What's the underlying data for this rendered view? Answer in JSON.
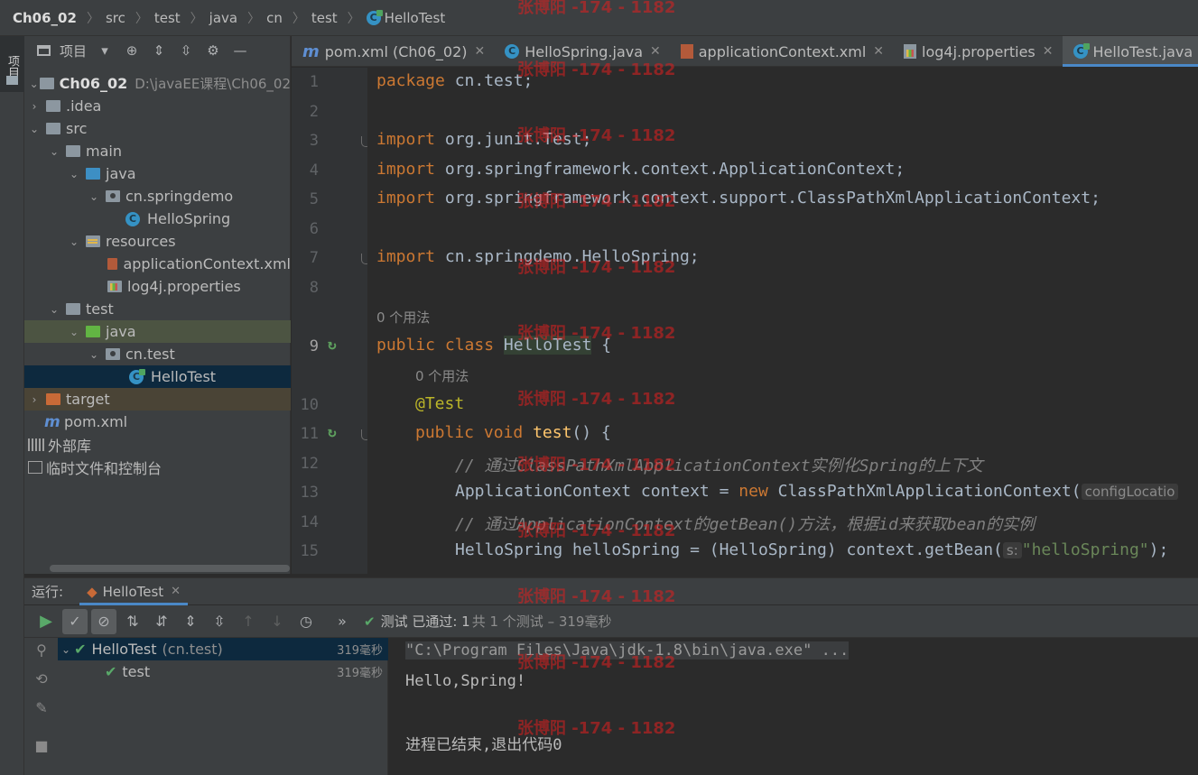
{
  "breadcrumb": {
    "items": [
      "Ch06_02",
      "src",
      "test",
      "java",
      "cn",
      "test",
      "HelloTest"
    ]
  },
  "left_stripe": {
    "project_tab": "项目"
  },
  "project_panel": {
    "title": "项目",
    "tree": [
      {
        "label": "Ch06_02",
        "path": "D:\\javaEE课程\\Ch06_02"
      },
      {
        "label": ".idea"
      },
      {
        "label": "src"
      },
      {
        "label": "main"
      },
      {
        "label": "java"
      },
      {
        "label": "cn.springdemo"
      },
      {
        "label": "HelloSpring"
      },
      {
        "label": "resources"
      },
      {
        "label": "applicationContext.xml"
      },
      {
        "label": "log4j.properties"
      },
      {
        "label": "test"
      },
      {
        "label": "java"
      },
      {
        "label": "cn.test"
      },
      {
        "label": "HelloTest"
      },
      {
        "label": "target"
      },
      {
        "label": "pom.xml"
      },
      {
        "label": "外部库"
      },
      {
        "label": "临时文件和控制台"
      }
    ]
  },
  "editor_tabs": [
    {
      "label": "pom.xml (Ch06_02)",
      "icon": "maven-icon"
    },
    {
      "label": "HelloSpring.java",
      "icon": "class-icon"
    },
    {
      "label": "applicationContext.xml",
      "icon": "xml-icon"
    },
    {
      "label": "log4j.properties",
      "icon": "properties-icon"
    },
    {
      "label": "HelloTest.java",
      "icon": "test-class-icon",
      "active": true
    }
  ],
  "code": {
    "line_numbers": [
      "1",
      "2",
      "3",
      "4",
      "5",
      "6",
      "7",
      "8",
      "9",
      "10",
      "11",
      "12",
      "13",
      "14",
      "15"
    ],
    "usage_hint": "0 个用法",
    "lines": {
      "l1_kw": "package",
      "l1_rest": " cn.test;",
      "l3_kw": "import",
      "l3_rest": " org.junit.Test;",
      "l4_kw": "import",
      "l4_rest": " org.springframework.context.ApplicationContext;",
      "l5_kw": "import",
      "l5_rest": " org.springframework.context.support.ClassPathXmlApplicationContext;",
      "l7_kw": "import",
      "l7_rest": " cn.springdemo.HelloSpring;",
      "l9_kw": "public class",
      "l9_name": "HelloTest",
      "l9_rest": " {",
      "l10_ann": "@Test",
      "l11_kw": "public void",
      "l11_fn": "test",
      "l11_rest": "() {",
      "l12_cmt": "// 通过ClassPathXmlApplicationContext实例化Spring的上下文",
      "l13_a": "ApplicationContext context = ",
      "l13_kw": "new",
      "l13_b": " ClassPathXmlApplicationContext(",
      "l13_hint": "configLocatio",
      "l14_cmt": "// 通过ApplicationContext的getBean()方法，根据id来获取bean的实例",
      "l15_a": "HelloSpring helloSpring = (HelloSpring) context.getBean(",
      "l15_hint": "s:",
      "l15_str": "\"helloSpring\"",
      "l15_b": ");"
    }
  },
  "run": {
    "label": "运行:",
    "tab": "HelloTest",
    "status_prefix": "测试 已通过: 1",
    "status_suffix": "共 1 个测试 – 319毫秒",
    "tests": [
      {
        "name": "HelloTest",
        "pkg": "(cn.test)",
        "time": "319毫秒"
      },
      {
        "name": "test",
        "time": "319毫秒"
      }
    ],
    "console": [
      "\"C:\\Program Files\\Java\\jdk-1.8\\bin\\java.exe\" ...",
      "Hello,Spring!",
      "进程已结束,退出代码0"
    ]
  },
  "watermark": "张博阳 -174 - 1182"
}
